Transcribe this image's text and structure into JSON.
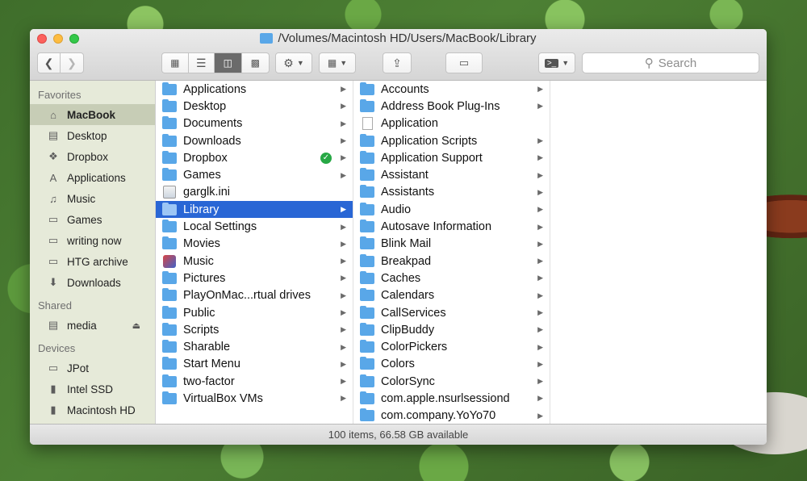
{
  "window": {
    "title": "/Volumes/Macintosh HD/Users/MacBook/Library",
    "status": "100 items, 66.58 GB available"
  },
  "toolbar": {
    "search_placeholder": "Search",
    "active_view": "column"
  },
  "sidebar": {
    "favorites_heading": "Favorites",
    "favorites": [
      {
        "label": "MacBook",
        "icon": "home-icon",
        "selected": true
      },
      {
        "label": "Desktop",
        "icon": "desktop-icon"
      },
      {
        "label": "Dropbox",
        "icon": "dropbox-icon"
      },
      {
        "label": "Applications",
        "icon": "applications-icon"
      },
      {
        "label": "Music",
        "icon": "music-icon"
      },
      {
        "label": "Games",
        "icon": "folder-icon"
      },
      {
        "label": "writing now",
        "icon": "folder-icon"
      },
      {
        "label": "HTG archive",
        "icon": "folder-icon"
      },
      {
        "label": "Downloads",
        "icon": "downloads-icon"
      }
    ],
    "shared_heading": "Shared",
    "shared": [
      {
        "label": "media",
        "icon": "server-icon"
      }
    ],
    "devices_heading": "Devices",
    "devices": [
      {
        "label": "JPot",
        "icon": "laptop-icon"
      },
      {
        "label": "Intel SSD",
        "icon": "disk-icon"
      },
      {
        "label": "Macintosh HD",
        "icon": "disk-icon"
      }
    ]
  },
  "column1": [
    {
      "label": "Applications",
      "kind": "folder"
    },
    {
      "label": "Desktop",
      "kind": "folder"
    },
    {
      "label": "Documents",
      "kind": "folder"
    },
    {
      "label": "Downloads",
      "kind": "folder"
    },
    {
      "label": "Dropbox",
      "kind": "folder",
      "synced": true
    },
    {
      "label": "Games",
      "kind": "folder"
    },
    {
      "label": "garglk.ini",
      "kind": "ini"
    },
    {
      "label": "Library",
      "kind": "folder",
      "selected": true
    },
    {
      "label": "Local Settings",
      "kind": "folder"
    },
    {
      "label": "Movies",
      "kind": "folder"
    },
    {
      "label": "Music",
      "kind": "app"
    },
    {
      "label": "Pictures",
      "kind": "folder"
    },
    {
      "label": "PlayOnMac...rtual drives",
      "kind": "folder"
    },
    {
      "label": "Public",
      "kind": "folder"
    },
    {
      "label": "Scripts",
      "kind": "folder"
    },
    {
      "label": "Sharable",
      "kind": "folder"
    },
    {
      "label": "Start Menu",
      "kind": "folder"
    },
    {
      "label": "two-factor",
      "kind": "folder"
    },
    {
      "label": "VirtualBox VMs",
      "kind": "folder"
    }
  ],
  "column2": [
    {
      "label": "Accounts",
      "kind": "folder"
    },
    {
      "label": "Address Book Plug-Ins",
      "kind": "folder"
    },
    {
      "label": "Application",
      "kind": "file"
    },
    {
      "label": "Application Scripts",
      "kind": "folder"
    },
    {
      "label": "Application Support",
      "kind": "folder"
    },
    {
      "label": "Assistant",
      "kind": "folder"
    },
    {
      "label": "Assistants",
      "kind": "folder"
    },
    {
      "label": "Audio",
      "kind": "folder"
    },
    {
      "label": "Autosave Information",
      "kind": "folder"
    },
    {
      "label": "Blink Mail",
      "kind": "folder"
    },
    {
      "label": "Breakpad",
      "kind": "folder"
    },
    {
      "label": "Caches",
      "kind": "folder"
    },
    {
      "label": "Calendars",
      "kind": "folder"
    },
    {
      "label": "CallServices",
      "kind": "folder"
    },
    {
      "label": "ClipBuddy",
      "kind": "folder"
    },
    {
      "label": "ColorPickers",
      "kind": "folder"
    },
    {
      "label": "Colors",
      "kind": "folder"
    },
    {
      "label": "ColorSync",
      "kind": "folder"
    },
    {
      "label": "com.apple.nsurlsessiond",
      "kind": "folder"
    },
    {
      "label": "com.company.YoYo70",
      "kind": "folder"
    }
  ],
  "colors": {
    "selection": "#2966d5",
    "folder": "#59a7e8",
    "sidebar_bg": "#e6ead9"
  }
}
